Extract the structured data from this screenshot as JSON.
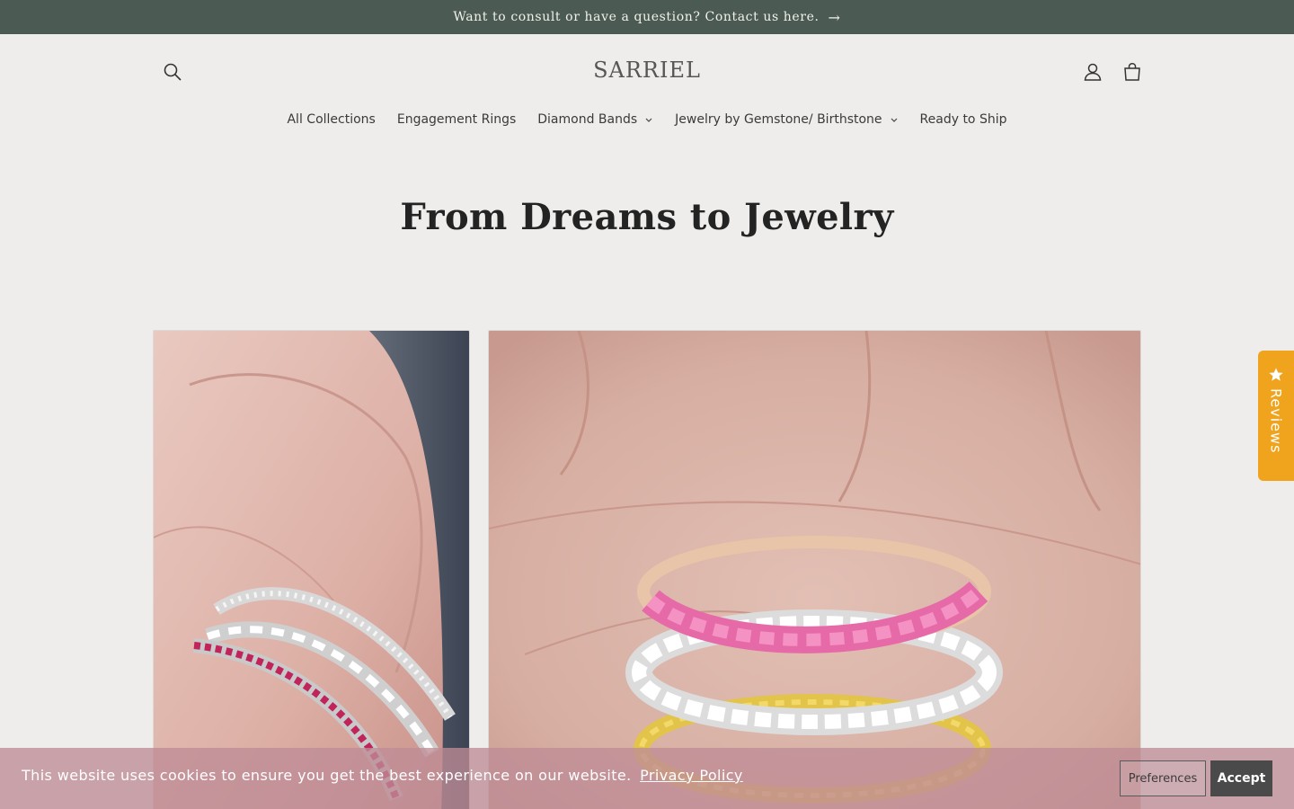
{
  "announcement": {
    "text": "Want to consult or have a question? Contact us here.",
    "arrow": "→"
  },
  "header": {
    "logo": "SARRIEL",
    "search_icon": "search-icon",
    "account_icon": "account-icon",
    "cart_icon": "cart-icon"
  },
  "nav": {
    "items": [
      {
        "label": "All Collections",
        "has_dropdown": false
      },
      {
        "label": "Engagement Rings",
        "has_dropdown": false
      },
      {
        "label": "Diamond Bands",
        "has_dropdown": true
      },
      {
        "label": "Jewelry by Gemstone/ Birthstone",
        "has_dropdown": true
      },
      {
        "label": "Ready to Ship",
        "has_dropdown": false
      }
    ]
  },
  "hero": {
    "title": "From Dreams to Jewelry"
  },
  "reviews_tab": {
    "label": "Reviews",
    "icon": "star-icon",
    "color": "#f0a31c"
  },
  "cookie": {
    "message": "This website uses cookies to ensure you get the best experience on our website.",
    "link": "Privacy Policy",
    "preferences": "Preferences",
    "accept": "Accept"
  },
  "colors": {
    "announcement_bg": "#4b5a52",
    "page_bg": "#eeedeb",
    "cookie_bg": "#be8c96"
  }
}
